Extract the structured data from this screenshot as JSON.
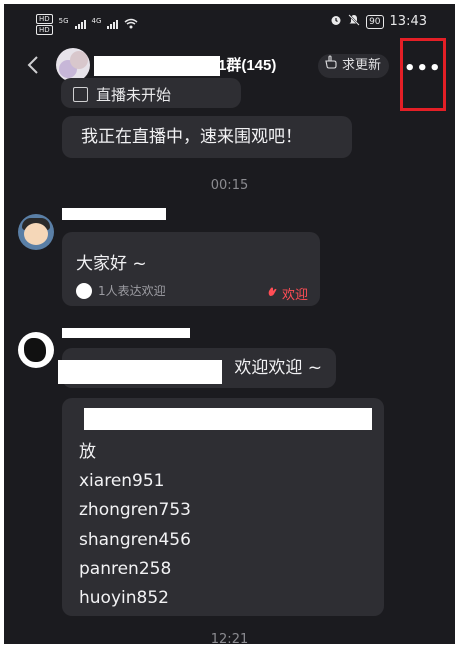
{
  "status_bar": {
    "sim1": "HD",
    "sim2": "HD",
    "net1": "5G",
    "net2": "4G",
    "battery": "90",
    "time": "13:43"
  },
  "header": {
    "back_icon": "chevron-left-icon",
    "title": "1群(145)",
    "update_button_label": "求更新",
    "more_icon": "more-dots-icon"
  },
  "messages": [
    {
      "text": "直播未开始",
      "partial": true
    },
    {
      "text": "我正在直播中，速来围观吧！"
    }
  ],
  "timestamps": [
    "00:15",
    "12:21"
  ],
  "greeting": {
    "text": "大家好 ~",
    "reaction_summary": "1人表达欢迎",
    "welcome_label": "欢迎"
  },
  "welcome_reply": "欢迎欢迎 ~",
  "list_message": {
    "lines": [
      "放",
      "xiaren951",
      "zhongren753",
      "shangren456",
      "panren258",
      "huoyin852"
    ]
  },
  "colors": {
    "background": "#1b1b1f",
    "bubble": "#2e2e33",
    "accent_red": "#ff4d55",
    "highlight_box": "#e41f26"
  }
}
